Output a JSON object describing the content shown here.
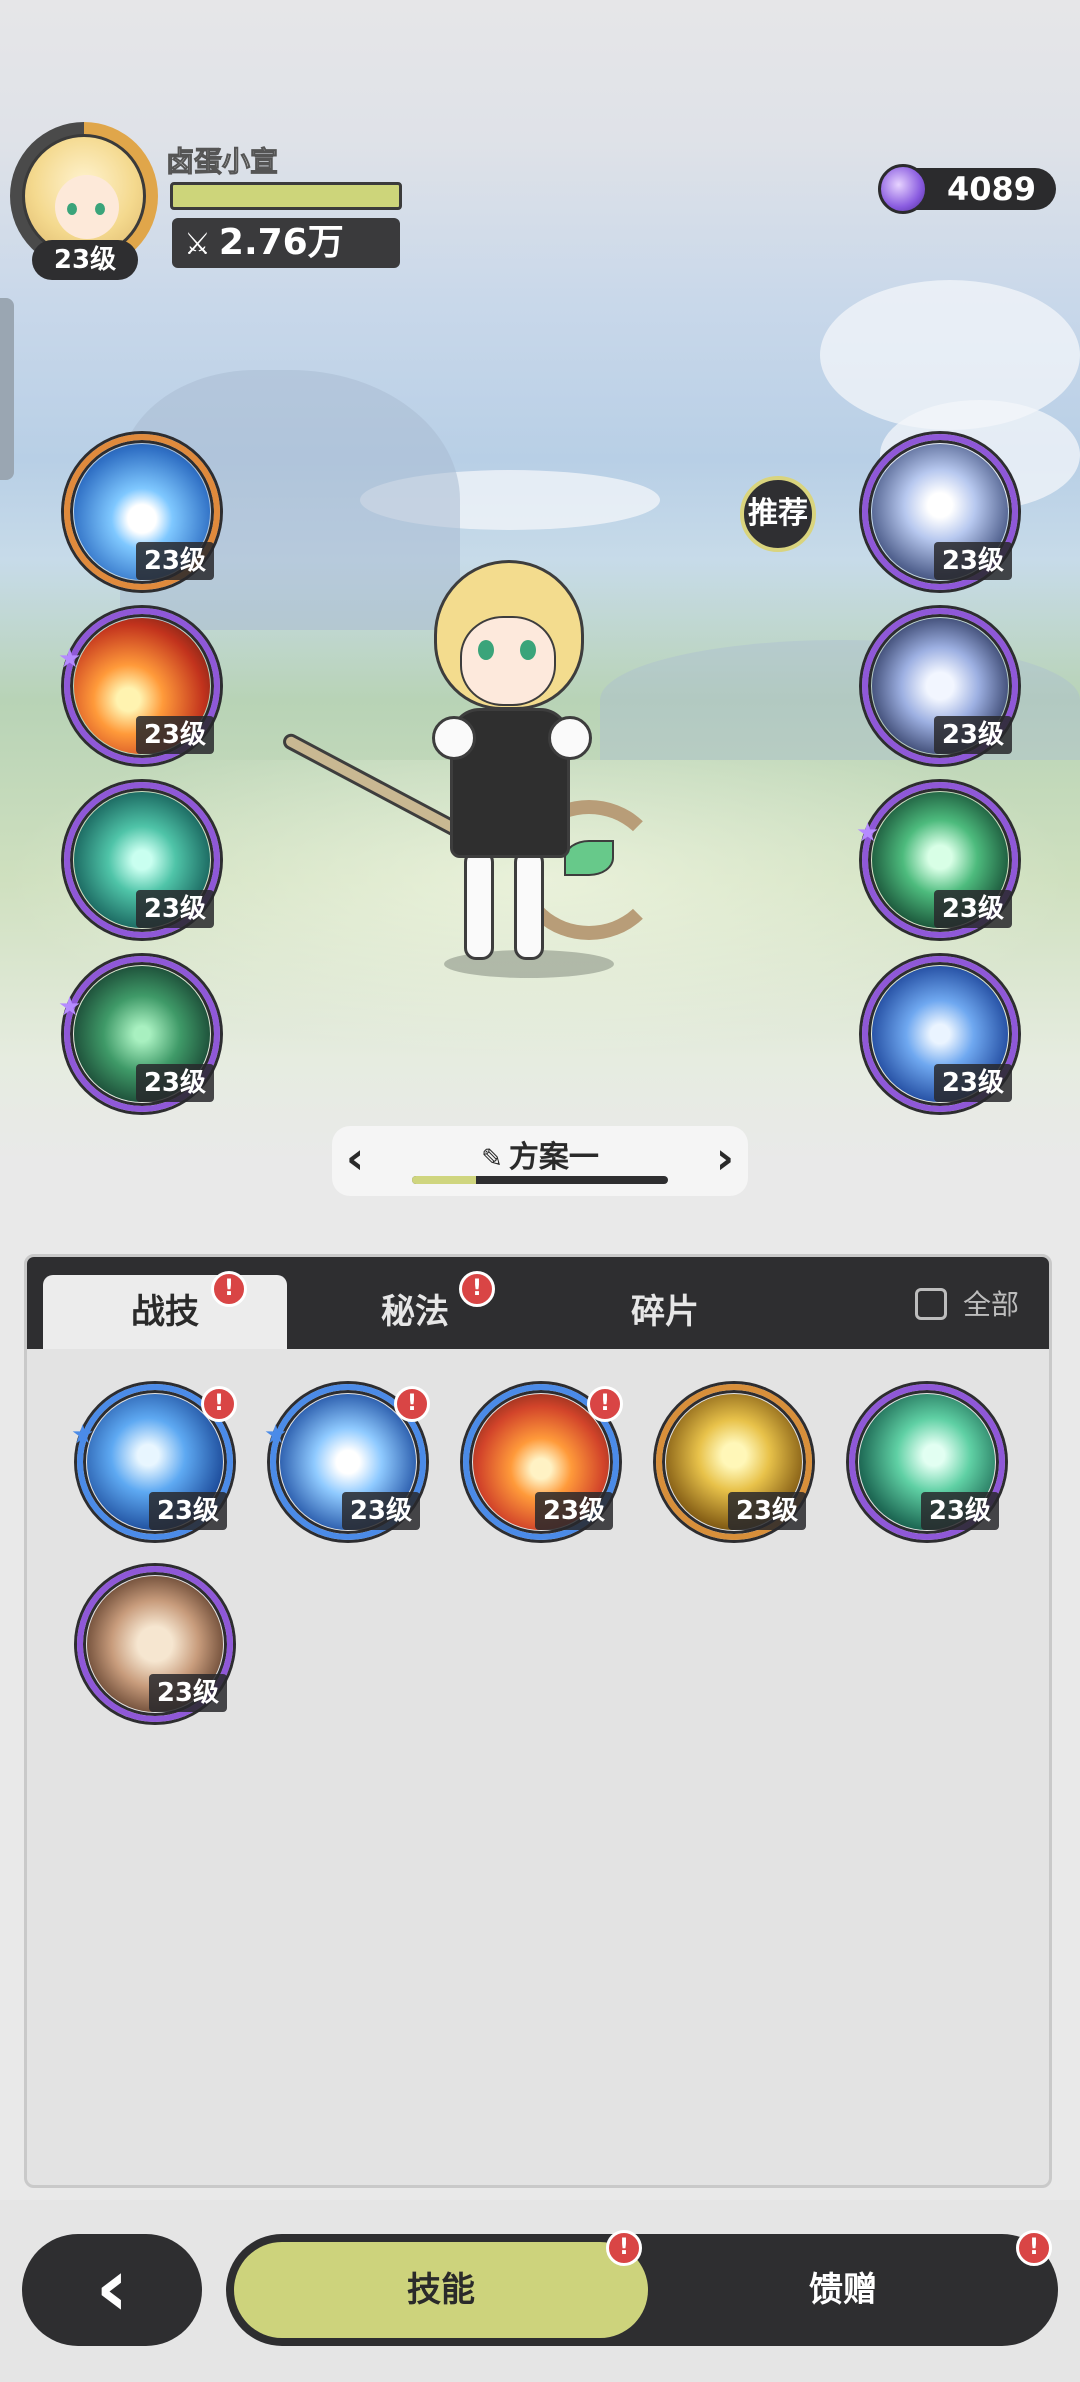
{
  "player": {
    "name": "卤蛋小宣",
    "level": "23级",
    "exp_fraction": 1.0,
    "power": "2.76万"
  },
  "currency": {
    "icon": "purple-crystal-icon",
    "amount": "4089"
  },
  "recommend_label": "推荐",
  "equipped_left": [
    {
      "icon": "ice-burst-icon",
      "level": "23级",
      "rarity": "orange",
      "starred": false
    },
    {
      "icon": "fire-explosion-icon",
      "level": "23级",
      "rarity": "purple",
      "starred": true
    },
    {
      "icon": "wind-vortex-icon",
      "level": "23级",
      "rarity": "purple",
      "starred": false
    },
    {
      "icon": "thorn-vine-icon",
      "level": "23级",
      "rarity": "purple",
      "starred": true
    }
  ],
  "equipped_right": [
    {
      "icon": "sparkle-crystal-icon",
      "level": "23级",
      "rarity": "purple",
      "starred": false
    },
    {
      "icon": "crystal-orb-icon",
      "level": "23级",
      "rarity": "purple",
      "starred": false
    },
    {
      "icon": "green-heart-icon",
      "level": "23级",
      "rarity": "purple",
      "starred": true
    },
    {
      "icon": "portal-figure-icon",
      "level": "23级",
      "rarity": "purple",
      "starred": false
    }
  ],
  "plan": {
    "name": "方案一",
    "progress": 0.25
  },
  "tabs": [
    {
      "label": "战技",
      "active": true,
      "badge": "!"
    },
    {
      "label": "秘法",
      "active": false,
      "badge": "!"
    },
    {
      "label": "碎片",
      "active": false,
      "badge": ""
    }
  ],
  "all_toggle_label": "全部",
  "skills": [
    {
      "icon": "blue-wave-icon",
      "level": "23级",
      "rarity": "blue",
      "badge": "!",
      "starred": true
    },
    {
      "icon": "ice-shard-icon",
      "level": "23级",
      "rarity": "blue",
      "badge": "!",
      "starred": true
    },
    {
      "icon": "fire-orb-icon",
      "level": "23级",
      "rarity": "blue",
      "badge": "!",
      "starred": false
    },
    {
      "icon": "golden-crystal-icon",
      "level": "23级",
      "rarity": "gold",
      "badge": "",
      "starred": false
    },
    {
      "icon": "green-slash-icon",
      "level": "23级",
      "rarity": "purple",
      "badge": "",
      "starred": false
    },
    {
      "icon": "red-card-icon",
      "level": "23级",
      "rarity": "purple",
      "badge": "",
      "starred": false
    }
  ],
  "bottom": {
    "back_icon": "chevron-left-icon",
    "skill_label": "技能",
    "gift_label": "馈赠",
    "skill_badge": "!",
    "gift_badge": "!"
  },
  "colors": {
    "purple_ring": "#8f58d8",
    "orange_ring": "#e08a3c",
    "blue_ring": "#4b8be8",
    "gold_ring": "#d88f3a",
    "accent_lime": "#cdd37c",
    "badge_red": "#d94545",
    "dark": "#2e2e30"
  }
}
